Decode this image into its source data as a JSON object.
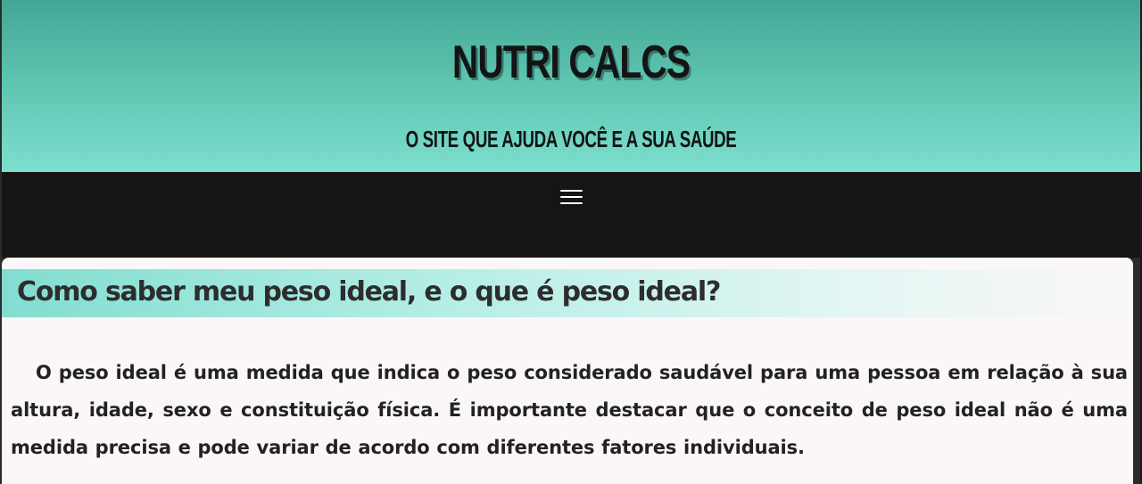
{
  "header": {
    "title": "NUTRI CALCS",
    "subtitle": "O SITE QUE AJUDA VOCÊ E A SUA SAÚDE",
    "gradient_top": "#44a796",
    "gradient_bottom": "#7ddfce"
  },
  "navbar": {
    "menu_icon": "hamburger-menu-icon",
    "background": "#151515"
  },
  "article": {
    "heading": "Como saber meu peso ideal, e o que é peso ideal?",
    "paragraph": "O peso ideal é uma medida que indica o peso considerado saudável para uma pessoa em relação à sua altura, idade, sexo e constituição física. É importante destacar que o conceito de peso ideal não é uma medida precisa e pode variar de acordo com diferentes fatores individuais.",
    "heading_accent": "#82ddd0"
  }
}
